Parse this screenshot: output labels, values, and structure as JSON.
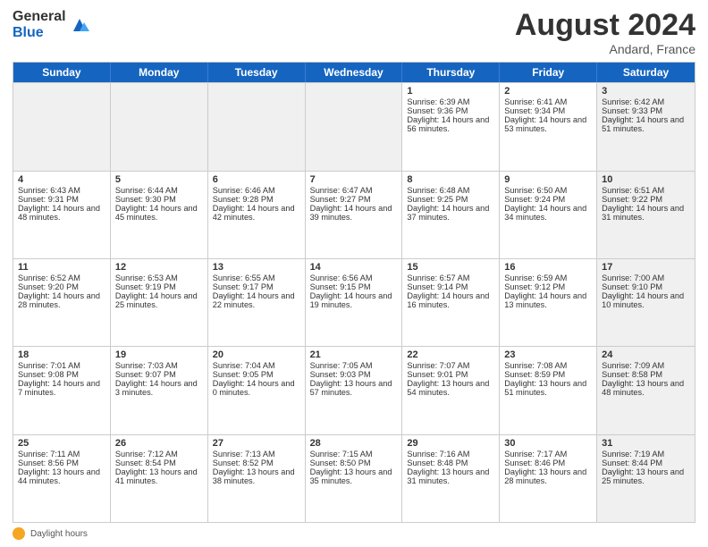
{
  "header": {
    "logo_general": "General",
    "logo_blue": "Blue",
    "month_title": "August 2024",
    "location": "Andard, France"
  },
  "days_of_week": [
    "Sunday",
    "Monday",
    "Tuesday",
    "Wednesday",
    "Thursday",
    "Friday",
    "Saturday"
  ],
  "weeks": [
    [
      {
        "day": "",
        "info": "",
        "shaded": true
      },
      {
        "day": "",
        "info": "",
        "shaded": true
      },
      {
        "day": "",
        "info": "",
        "shaded": true
      },
      {
        "day": "",
        "info": "",
        "shaded": true
      },
      {
        "day": "1",
        "info": "Sunrise: 6:39 AM\nSunset: 9:36 PM\nDaylight: 14 hours and 56 minutes.",
        "shaded": false
      },
      {
        "day": "2",
        "info": "Sunrise: 6:41 AM\nSunset: 9:34 PM\nDaylight: 14 hours and 53 minutes.",
        "shaded": false
      },
      {
        "day": "3",
        "info": "Sunrise: 6:42 AM\nSunset: 9:33 PM\nDaylight: 14 hours and 51 minutes.",
        "shaded": true
      }
    ],
    [
      {
        "day": "4",
        "info": "Sunrise: 6:43 AM\nSunset: 9:31 PM\nDaylight: 14 hours and 48 minutes.",
        "shaded": false
      },
      {
        "day": "5",
        "info": "Sunrise: 6:44 AM\nSunset: 9:30 PM\nDaylight: 14 hours and 45 minutes.",
        "shaded": false
      },
      {
        "day": "6",
        "info": "Sunrise: 6:46 AM\nSunset: 9:28 PM\nDaylight: 14 hours and 42 minutes.",
        "shaded": false
      },
      {
        "day": "7",
        "info": "Sunrise: 6:47 AM\nSunset: 9:27 PM\nDaylight: 14 hours and 39 minutes.",
        "shaded": false
      },
      {
        "day": "8",
        "info": "Sunrise: 6:48 AM\nSunset: 9:25 PM\nDaylight: 14 hours and 37 minutes.",
        "shaded": false
      },
      {
        "day": "9",
        "info": "Sunrise: 6:50 AM\nSunset: 9:24 PM\nDaylight: 14 hours and 34 minutes.",
        "shaded": false
      },
      {
        "day": "10",
        "info": "Sunrise: 6:51 AM\nSunset: 9:22 PM\nDaylight: 14 hours and 31 minutes.",
        "shaded": true
      }
    ],
    [
      {
        "day": "11",
        "info": "Sunrise: 6:52 AM\nSunset: 9:20 PM\nDaylight: 14 hours and 28 minutes.",
        "shaded": false
      },
      {
        "day": "12",
        "info": "Sunrise: 6:53 AM\nSunset: 9:19 PM\nDaylight: 14 hours and 25 minutes.",
        "shaded": false
      },
      {
        "day": "13",
        "info": "Sunrise: 6:55 AM\nSunset: 9:17 PM\nDaylight: 14 hours and 22 minutes.",
        "shaded": false
      },
      {
        "day": "14",
        "info": "Sunrise: 6:56 AM\nSunset: 9:15 PM\nDaylight: 14 hours and 19 minutes.",
        "shaded": false
      },
      {
        "day": "15",
        "info": "Sunrise: 6:57 AM\nSunset: 9:14 PM\nDaylight: 14 hours and 16 minutes.",
        "shaded": false
      },
      {
        "day": "16",
        "info": "Sunrise: 6:59 AM\nSunset: 9:12 PM\nDaylight: 14 hours and 13 minutes.",
        "shaded": false
      },
      {
        "day": "17",
        "info": "Sunrise: 7:00 AM\nSunset: 9:10 PM\nDaylight: 14 hours and 10 minutes.",
        "shaded": true
      }
    ],
    [
      {
        "day": "18",
        "info": "Sunrise: 7:01 AM\nSunset: 9:08 PM\nDaylight: 14 hours and 7 minutes.",
        "shaded": false
      },
      {
        "day": "19",
        "info": "Sunrise: 7:03 AM\nSunset: 9:07 PM\nDaylight: 14 hours and 3 minutes.",
        "shaded": false
      },
      {
        "day": "20",
        "info": "Sunrise: 7:04 AM\nSunset: 9:05 PM\nDaylight: 14 hours and 0 minutes.",
        "shaded": false
      },
      {
        "day": "21",
        "info": "Sunrise: 7:05 AM\nSunset: 9:03 PM\nDaylight: 13 hours and 57 minutes.",
        "shaded": false
      },
      {
        "day": "22",
        "info": "Sunrise: 7:07 AM\nSunset: 9:01 PM\nDaylight: 13 hours and 54 minutes.",
        "shaded": false
      },
      {
        "day": "23",
        "info": "Sunrise: 7:08 AM\nSunset: 8:59 PM\nDaylight: 13 hours and 51 minutes.",
        "shaded": false
      },
      {
        "day": "24",
        "info": "Sunrise: 7:09 AM\nSunset: 8:58 PM\nDaylight: 13 hours and 48 minutes.",
        "shaded": true
      }
    ],
    [
      {
        "day": "25",
        "info": "Sunrise: 7:11 AM\nSunset: 8:56 PM\nDaylight: 13 hours and 44 minutes.",
        "shaded": false
      },
      {
        "day": "26",
        "info": "Sunrise: 7:12 AM\nSunset: 8:54 PM\nDaylight: 13 hours and 41 minutes.",
        "shaded": false
      },
      {
        "day": "27",
        "info": "Sunrise: 7:13 AM\nSunset: 8:52 PM\nDaylight: 13 hours and 38 minutes.",
        "shaded": false
      },
      {
        "day": "28",
        "info": "Sunrise: 7:15 AM\nSunset: 8:50 PM\nDaylight: 13 hours and 35 minutes.",
        "shaded": false
      },
      {
        "day": "29",
        "info": "Sunrise: 7:16 AM\nSunset: 8:48 PM\nDaylight: 13 hours and 31 minutes.",
        "shaded": false
      },
      {
        "day": "30",
        "info": "Sunrise: 7:17 AM\nSunset: 8:46 PM\nDaylight: 13 hours and 28 minutes.",
        "shaded": false
      },
      {
        "day": "31",
        "info": "Sunrise: 7:19 AM\nSunset: 8:44 PM\nDaylight: 13 hours and 25 minutes.",
        "shaded": true
      }
    ]
  ],
  "footer": {
    "sun_label": "Daylight hours"
  }
}
